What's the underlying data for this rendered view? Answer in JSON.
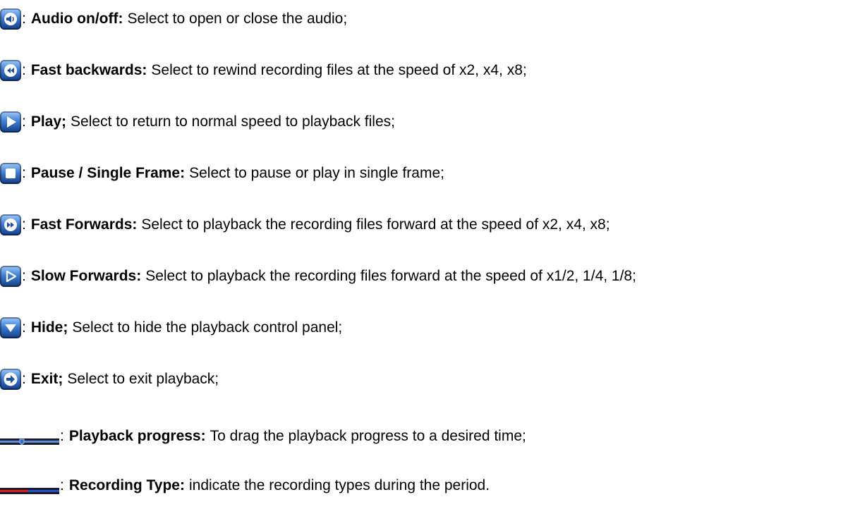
{
  "items": [
    {
      "icon": "speaker-icon",
      "colon": ":",
      "term": "Audio on/off:",
      "desc": "Select to open or close the audio;"
    },
    {
      "icon": "fast-backward-icon",
      "colon": ":",
      "term": "Fast backwards:",
      "desc": "Select to rewind recording files at the speed of x2, x4, x8;"
    },
    {
      "icon": "play-icon",
      "colon": ":",
      "term": "Play;",
      "desc": "Select to return to normal speed to playback files;"
    },
    {
      "icon": "stop-icon",
      "colon": ":",
      "term": "Pause / Single Frame:",
      "desc": "Select to pause or play in single frame;"
    },
    {
      "icon": "fast-forward-icon",
      "colon": ":",
      "term": "Fast Forwards:",
      "desc": "Select to playback the recording files forward at the speed of x2, x4, x8;"
    },
    {
      "icon": "slow-forward-icon",
      "colon": ":",
      "term": "Slow Forwards:",
      "desc": "Select to playback the recording files forward at the speed of x1/2, 1/4, 1/8;"
    },
    {
      "icon": "hide-down-arrow-icon",
      "colon": ":",
      "term": "Hide;",
      "desc": "Select to hide the playback control panel;"
    },
    {
      "icon": "exit-arrow-icon",
      "colon": ":",
      "term": "Exit;",
      "desc": "Select to exit playback;"
    },
    {
      "icon": "progress-bar-icon",
      "colon": ":",
      "term": "Playback progress:",
      "desc": "To drag the playback progress to a desired time;"
    },
    {
      "icon": "recording-type-bar-icon",
      "colon": ":",
      "term": "Recording Type:",
      "desc": "indicate the recording types during the period."
    }
  ],
  "colors": {
    "button_blue_dark": "#1f4e9b",
    "button_blue_light": "#6fa6e8",
    "bar_dark": "#1b1b2b",
    "bar_blue": "#1e52c8",
    "bar_red": "#e01b1b"
  }
}
